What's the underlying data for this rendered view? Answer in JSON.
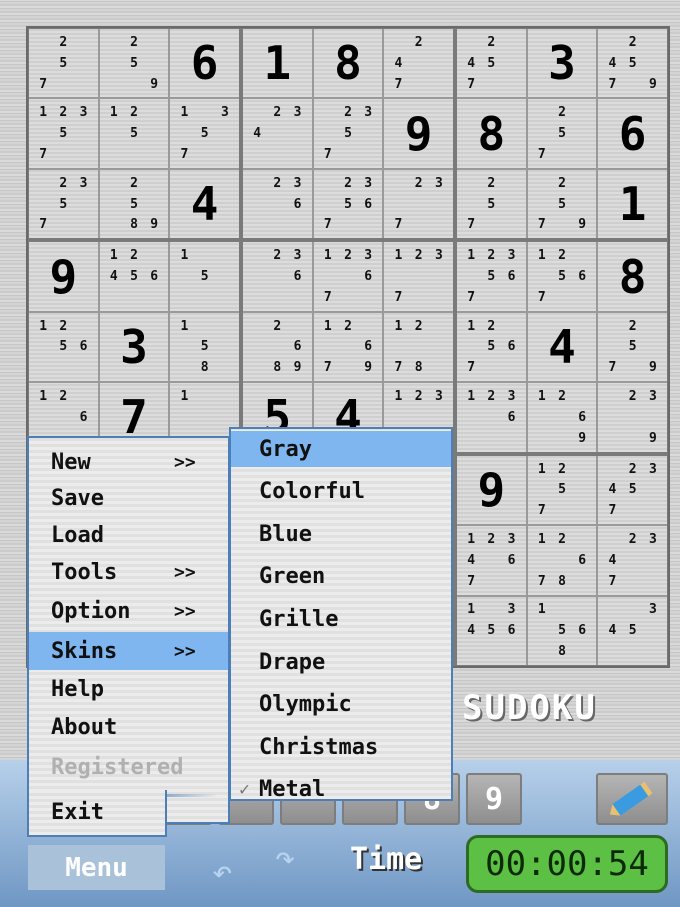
{
  "board": {
    "cells": [
      [
        "c257",
        "c259",
        "6",
        "1",
        "8",
        "c247",
        "c2457",
        "3",
        "c24579"
      ],
      [
        "c12357",
        "c125",
        "c1357",
        "c234",
        "c2357",
        "9",
        "8",
        "c257",
        "6"
      ],
      [
        "c2357",
        "c2589",
        "4",
        "c236",
        "c23567",
        "c237",
        "c257",
        "c2579",
        "1"
      ],
      [
        "9",
        "c12456",
        "c15",
        "c236",
        "c12367",
        "c1237",
        "c123567",
        "c12567",
        "8"
      ],
      [
        "c1256",
        "3",
        "c158",
        "c2689",
        "c12679",
        "c1278",
        "c12567",
        "4",
        "c2579"
      ],
      [
        "c126",
        "7",
        "c1",
        "5",
        "4",
        "c123",
        "c1236",
        "c1269",
        "c239"
      ],
      [
        "",
        "",
        "",
        "",
        "",
        "",
        "9",
        "c1257",
        "c23457"
      ],
      [
        "",
        "",
        "",
        "",
        "",
        "",
        "c123467",
        "c12678",
        "c2347"
      ],
      [
        "",
        "",
        "",
        "",
        "",
        "",
        "c13456",
        "c1568",
        "c345"
      ]
    ]
  },
  "logo": "SUDOKU",
  "number_buttons": [
    "",
    "",
    "",
    "",
    "",
    "8",
    "9"
  ],
  "main_menu": [
    {
      "label": "New",
      "arrow": ">>"
    },
    {
      "label": "Save",
      "arrow": ""
    },
    {
      "label": "Load",
      "arrow": ""
    },
    {
      "label": "Tools",
      "arrow": ">>"
    },
    {
      "label": "Option",
      "arrow": ">>"
    },
    {
      "label": "Skins",
      "arrow": ">>",
      "highlighted": true
    },
    {
      "label": "Help",
      "arrow": ""
    },
    {
      "label": "About",
      "arrow": ""
    },
    {
      "label": "Registered",
      "arrow": "",
      "disabled": true
    },
    {
      "label": "Exit",
      "arrow": ""
    }
  ],
  "skins_menu": [
    {
      "label": "Gray",
      "highlighted": true
    },
    {
      "label": "Colorful"
    },
    {
      "label": "Blue"
    },
    {
      "label": "Green"
    },
    {
      "label": "Grille"
    },
    {
      "label": "Drape"
    },
    {
      "label": "Olympic"
    },
    {
      "label": "Christmas"
    },
    {
      "label": "Metal",
      "checked": true
    }
  ],
  "check_mark": "✓",
  "menu_button": "Menu",
  "time_label": "Time",
  "timer": "00:00:54",
  "colors": {
    "highlight": "#7fb6f0",
    "timer_bg": "#5cc045",
    "menu_border": "#4c7fb8"
  }
}
